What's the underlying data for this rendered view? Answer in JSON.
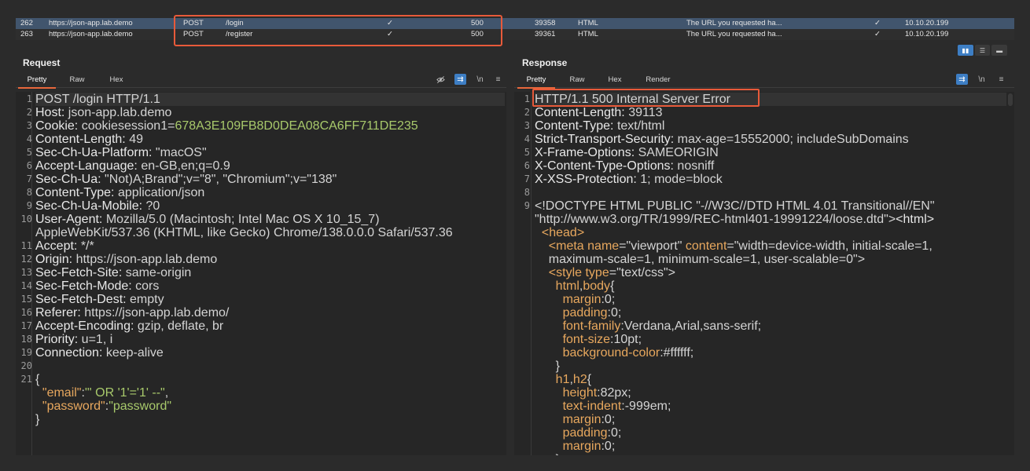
{
  "history": {
    "rows": [
      {
        "id": "262",
        "host": "https://json-app.lab.demo",
        "method": "POST",
        "url": "/login",
        "edited": "✓",
        "status": "500",
        "length": "39358",
        "mime": "HTML",
        "title": "The URL you requested ha...",
        "tls": "✓",
        "ip": "10.10.20.199"
      },
      {
        "id": "263",
        "host": "https://json-app.lab.demo",
        "method": "POST",
        "url": "/register",
        "edited": "✓",
        "status": "500",
        "length": "39361",
        "mime": "HTML",
        "title": "The URL you requested ha...",
        "tls": "✓",
        "ip": "10.10.20.199"
      }
    ]
  },
  "request": {
    "title": "Request",
    "tabs": [
      "Pretty",
      "Raw",
      "Hex"
    ],
    "lines": [
      {
        "n": "1",
        "parts": [
          [
            "v",
            "POST /login HTTP/1.1"
          ]
        ]
      },
      {
        "n": "2",
        "parts": [
          [
            "k",
            "Host: "
          ],
          [
            "v",
            "json-app.lab.demo"
          ]
        ]
      },
      {
        "n": "3",
        "parts": [
          [
            "k",
            "Cookie: "
          ],
          [
            "v",
            "cookiesession1="
          ],
          [
            "g",
            "678A3E109FB8D0DEA08CA6FF711DE235"
          ]
        ]
      },
      {
        "n": "4",
        "parts": [
          [
            "k",
            "Content-Length: "
          ],
          [
            "v",
            "49"
          ]
        ]
      },
      {
        "n": "5",
        "parts": [
          [
            "k",
            "Sec-Ch-Ua-Platform: "
          ],
          [
            "v",
            "\"macOS\""
          ]
        ]
      },
      {
        "n": "6",
        "parts": [
          [
            "k",
            "Accept-Language: "
          ],
          [
            "v",
            "en-GB,en;q=0.9"
          ]
        ]
      },
      {
        "n": "7",
        "parts": [
          [
            "k",
            "Sec-Ch-Ua: "
          ],
          [
            "v",
            "\"Not)A;Brand\";v=\"8\", \"Chromium\";v=\"138\""
          ]
        ]
      },
      {
        "n": "8",
        "parts": [
          [
            "k",
            "Content-Type: "
          ],
          [
            "v",
            "application/json"
          ]
        ]
      },
      {
        "n": "9",
        "parts": [
          [
            "k",
            "Sec-Ch-Ua-Mobile: "
          ],
          [
            "v",
            "?0"
          ]
        ]
      },
      {
        "n": "10",
        "parts": [
          [
            "k",
            "User-Agent: "
          ],
          [
            "v",
            "Mozilla/5.0 (Macintosh; Intel Mac OS X 10_15_7)"
          ]
        ]
      },
      {
        "n": "",
        "parts": [
          [
            "v",
            "AppleWebKit/537.36 (KHTML, like Gecko) Chrome/138.0.0.0 Safari/537.36"
          ]
        ]
      },
      {
        "n": "11",
        "parts": [
          [
            "k",
            "Accept: "
          ],
          [
            "v",
            "*/*"
          ]
        ]
      },
      {
        "n": "12",
        "parts": [
          [
            "k",
            "Origin: "
          ],
          [
            "v",
            "https://json-app.lab.demo"
          ]
        ]
      },
      {
        "n": "13",
        "parts": [
          [
            "k",
            "Sec-Fetch-Site: "
          ],
          [
            "v",
            "same-origin"
          ]
        ]
      },
      {
        "n": "14",
        "parts": [
          [
            "k",
            "Sec-Fetch-Mode: "
          ],
          [
            "v",
            "cors"
          ]
        ]
      },
      {
        "n": "15",
        "parts": [
          [
            "k",
            "Sec-Fetch-Dest: "
          ],
          [
            "v",
            "empty"
          ]
        ]
      },
      {
        "n": "16",
        "parts": [
          [
            "k",
            "Referer: "
          ],
          [
            "v",
            "https://json-app.lab.demo/"
          ]
        ]
      },
      {
        "n": "17",
        "parts": [
          [
            "k",
            "Accept-Encoding: "
          ],
          [
            "v",
            "gzip, deflate, br"
          ]
        ]
      },
      {
        "n": "18",
        "parts": [
          [
            "k",
            "Priority: "
          ],
          [
            "v",
            "u=1, i"
          ]
        ]
      },
      {
        "n": "19",
        "parts": [
          [
            "k",
            "Connection: "
          ],
          [
            "v",
            "keep-alive"
          ]
        ]
      },
      {
        "n": "20",
        "parts": []
      },
      {
        "n": "21",
        "parts": [
          [
            "v",
            "{"
          ]
        ]
      },
      {
        "n": "",
        "parts": [
          [
            "v",
            "  "
          ],
          [
            "o",
            "\"email\""
          ],
          [
            "v",
            ":"
          ],
          [
            "g",
            "\"' OR '1'='1' --\""
          ],
          [
            "v",
            ","
          ]
        ]
      },
      {
        "n": "",
        "parts": [
          [
            "v",
            "  "
          ],
          [
            "o",
            "\"password\""
          ],
          [
            "v",
            ":"
          ],
          [
            "g",
            "\"password\""
          ]
        ]
      },
      {
        "n": "",
        "parts": [
          [
            "v",
            "}"
          ]
        ]
      }
    ]
  },
  "response": {
    "title": "Response",
    "tabs": [
      "Pretty",
      "Raw",
      "Hex",
      "Render"
    ],
    "lines": [
      {
        "n": "1",
        "parts": [
          [
            "v",
            "HTTP/1.1 500 Internal Server Error"
          ]
        ]
      },
      {
        "n": "2",
        "parts": [
          [
            "k",
            "Content-Length: "
          ],
          [
            "v",
            "39113"
          ]
        ]
      },
      {
        "n": "3",
        "parts": [
          [
            "k",
            "Content-Type: "
          ],
          [
            "v",
            "text/html"
          ]
        ]
      },
      {
        "n": "4",
        "parts": [
          [
            "k",
            "Strict-Transport-Security: "
          ],
          [
            "v",
            "max-age=15552000; includeSubDomains"
          ]
        ]
      },
      {
        "n": "5",
        "parts": [
          [
            "k",
            "X-Frame-Options: "
          ],
          [
            "v",
            "SAMEORIGIN"
          ]
        ]
      },
      {
        "n": "6",
        "parts": [
          [
            "k",
            "X-Content-Type-Options: "
          ],
          [
            "v",
            "nosniff"
          ]
        ]
      },
      {
        "n": "7",
        "parts": [
          [
            "k",
            "X-XSS-Protection: "
          ],
          [
            "v",
            "1; mode=block"
          ]
        ]
      },
      {
        "n": "8",
        "parts": []
      },
      {
        "n": "9",
        "parts": [
          [
            "v",
            "<!DOCTYPE HTML PUBLIC \"-//W3C//DTD HTML 4.01 Transitional//EN\""
          ]
        ]
      },
      {
        "n": "",
        "parts": [
          [
            "v",
            "\"http://www.w3.org/TR/1999/REC-html401-19991224/loose.dtd\">"
          ],
          [
            "tag",
            "<html>"
          ]
        ]
      },
      {
        "n": "",
        "parts": [
          [
            "v",
            "  "
          ],
          [
            "o",
            "<head>"
          ]
        ]
      },
      {
        "n": "",
        "parts": [
          [
            "v",
            "    "
          ],
          [
            "o",
            "<meta "
          ],
          [
            "attr",
            "name"
          ],
          [
            "v",
            "=\"viewport\" "
          ],
          [
            "attr",
            "content"
          ],
          [
            "v",
            "=\"width=device-width, initial-scale=1,"
          ]
        ]
      },
      {
        "n": "",
        "parts": [
          [
            "v",
            "    maximum-scale=1, minimum-scale=1, user-scalable=0\">"
          ]
        ]
      },
      {
        "n": "",
        "parts": [
          [
            "v",
            "    "
          ],
          [
            "o",
            "<style "
          ],
          [
            "attr",
            "type"
          ],
          [
            "v",
            "=\"text/css\">"
          ]
        ]
      },
      {
        "n": "",
        "parts": [
          [
            "v",
            "      "
          ],
          [
            "o",
            "html"
          ],
          [
            "v",
            ","
          ],
          [
            "o",
            "body"
          ],
          [
            "v",
            "{"
          ]
        ]
      },
      {
        "n": "",
        "parts": [
          [
            "v",
            "        "
          ],
          [
            "o",
            "margin"
          ],
          [
            "v",
            ":0;"
          ]
        ]
      },
      {
        "n": "",
        "parts": [
          [
            "v",
            "        "
          ],
          [
            "o",
            "padding"
          ],
          [
            "v",
            ":0;"
          ]
        ]
      },
      {
        "n": "",
        "parts": [
          [
            "v",
            "        "
          ],
          [
            "o",
            "font-family"
          ],
          [
            "v",
            ":Verdana,Arial,sans-serif;"
          ]
        ]
      },
      {
        "n": "",
        "parts": [
          [
            "v",
            "        "
          ],
          [
            "o",
            "font-size"
          ],
          [
            "v",
            ":10pt;"
          ]
        ]
      },
      {
        "n": "",
        "parts": [
          [
            "v",
            "        "
          ],
          [
            "o",
            "background-color"
          ],
          [
            "v",
            ":#ffffff;"
          ]
        ]
      },
      {
        "n": "",
        "parts": [
          [
            "v",
            "      }"
          ]
        ]
      },
      {
        "n": "",
        "parts": [
          [
            "v",
            "      "
          ],
          [
            "o",
            "h1"
          ],
          [
            "v",
            ","
          ],
          [
            "o",
            "h2"
          ],
          [
            "v",
            "{"
          ]
        ]
      },
      {
        "n": "",
        "parts": [
          [
            "v",
            "        "
          ],
          [
            "o",
            "height"
          ],
          [
            "v",
            ":82px;"
          ]
        ]
      },
      {
        "n": "",
        "parts": [
          [
            "v",
            "        "
          ],
          [
            "o",
            "text-indent"
          ],
          [
            "v",
            ":-999em;"
          ]
        ]
      },
      {
        "n": "",
        "parts": [
          [
            "v",
            "        "
          ],
          [
            "o",
            "margin"
          ],
          [
            "v",
            ":0;"
          ]
        ]
      },
      {
        "n": "",
        "parts": [
          [
            "v",
            "        "
          ],
          [
            "o",
            "padding"
          ],
          [
            "v",
            ":0;"
          ]
        ]
      },
      {
        "n": "",
        "parts": [
          [
            "v",
            "        "
          ],
          [
            "o",
            "margin"
          ],
          [
            "v",
            ":0;"
          ]
        ]
      },
      {
        "n": "",
        "parts": [
          [
            "v",
            "      }"
          ]
        ]
      }
    ]
  },
  "icons": {
    "hide": "eye-slash-icon",
    "wrap": "wrap-icon",
    "newline": "\\n",
    "menu": "menu-icon"
  },
  "colors": {
    "accent": "#e8673b",
    "highlight": "#e85a3a",
    "selected_row": "#41556d",
    "toggle_on": "#3d7ec4"
  }
}
